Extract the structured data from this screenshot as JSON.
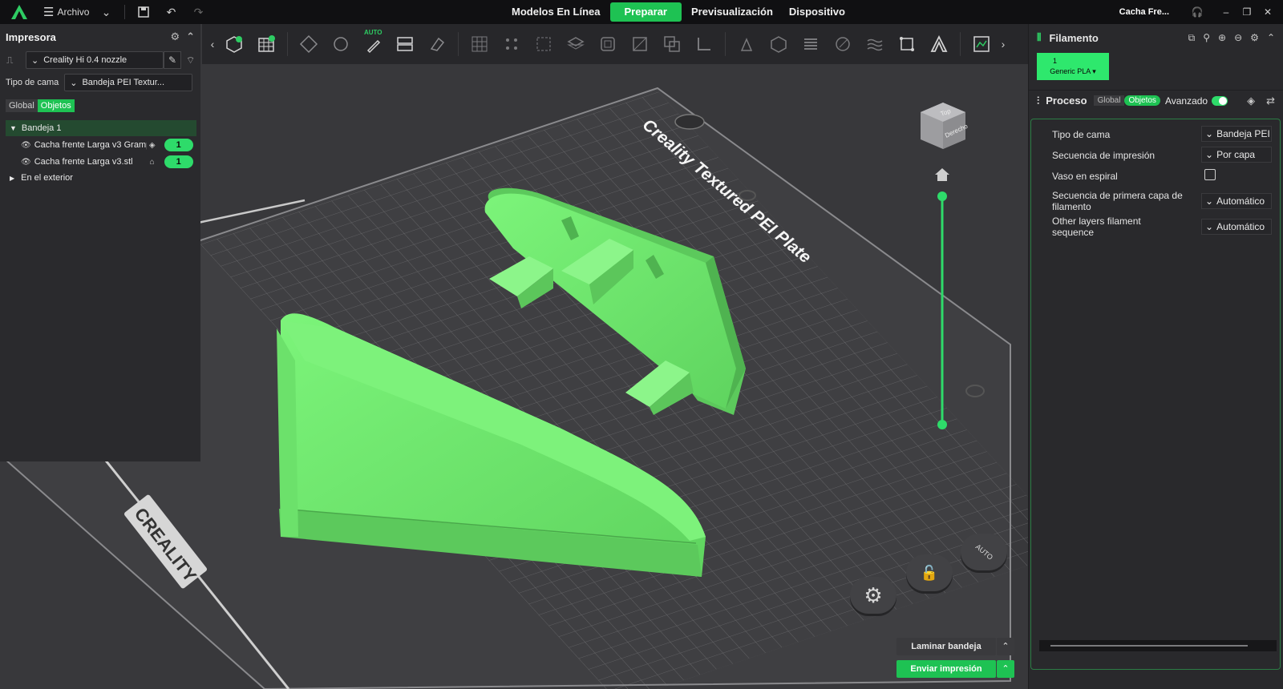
{
  "topbar": {
    "menu_label": "Archivo",
    "tabs": [
      {
        "label": "Modelos En Línea"
      },
      {
        "label": "Preparar"
      },
      {
        "label": "Previsualización"
      },
      {
        "label": "Dispositivo"
      }
    ],
    "project_name": "Cacha Fre...",
    "accent_color": "#1ec253"
  },
  "left_panel": {
    "title": "Impresora",
    "printer": "Creality Hi 0.4 nozzle",
    "bed_type_label": "Tipo de cama",
    "bed_type_value": "Bandeja PEI Textur...",
    "seg_global": "Global",
    "seg_objects": "Objetos",
    "tree": {
      "plate_label": "Bandeja 1",
      "objects": [
        {
          "name": "Cacha frente Larga v3 Gramp",
          "count": "1"
        },
        {
          "name": "Cacha frente Larga v3.stl",
          "count": "1"
        }
      ],
      "outside_label": "En el exterior"
    }
  },
  "right_panel": {
    "filament_title": "Filamento",
    "filament_slot": "1",
    "filament_name": "Generic PLA",
    "process_title": "Proceso",
    "seg_global": "Global",
    "seg_objects": "Objetos",
    "advanced_label": "Avanzado",
    "params": [
      {
        "label": "Tipo de cama",
        "value": "Bandeja PEI"
      },
      {
        "label": "Secuencia de impresión",
        "value": "Por capa"
      },
      {
        "label": "Vaso en espiral",
        "value": ""
      },
      {
        "label": "Secuencia de primera capa de filamento",
        "value": "Automático"
      },
      {
        "label": "Other layers filament sequence",
        "value": "Automático"
      }
    ]
  },
  "viewport": {
    "plate_text": "Creality Textured PEI Plate",
    "brand_text": "CREALITY",
    "cube_top": "Top",
    "cube_right": "Derecho",
    "auto_label": "AUTO",
    "model_color": "#6ee86f"
  },
  "actions": {
    "slice_label": "Laminar bandeja",
    "print_label": "Enviar impresión"
  },
  "toolbar": {
    "auto_label": "AUTO"
  }
}
